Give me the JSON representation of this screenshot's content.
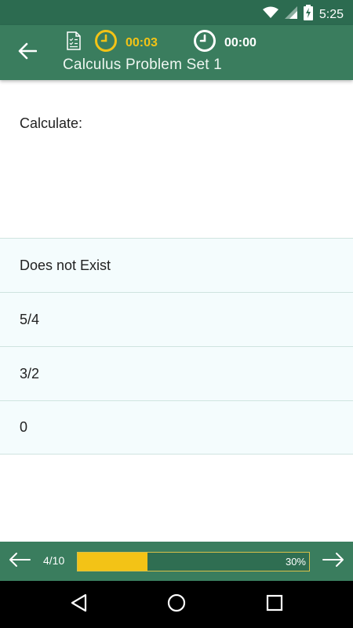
{
  "status_bar": {
    "time": "5:25"
  },
  "header": {
    "timer_elapsed": "00:03",
    "timer_total": "00:00",
    "title": "Calculus Problem Set 1",
    "icons": [
      "arrow-back-icon",
      "document-checklist-icon",
      "clock-icon"
    ]
  },
  "question": {
    "prompt": "Calculate:"
  },
  "answers": [
    {
      "label": "Does not Exist"
    },
    {
      "label": "5/4"
    },
    {
      "label": "3/2"
    },
    {
      "label": "0"
    }
  ],
  "footer": {
    "page": "4/10",
    "progress_label": "30%",
    "progress_value": 0.3
  },
  "colors": {
    "primary": "#3a7d5e",
    "accent": "#f3c316",
    "answer_bg": "#f4fcfd"
  }
}
